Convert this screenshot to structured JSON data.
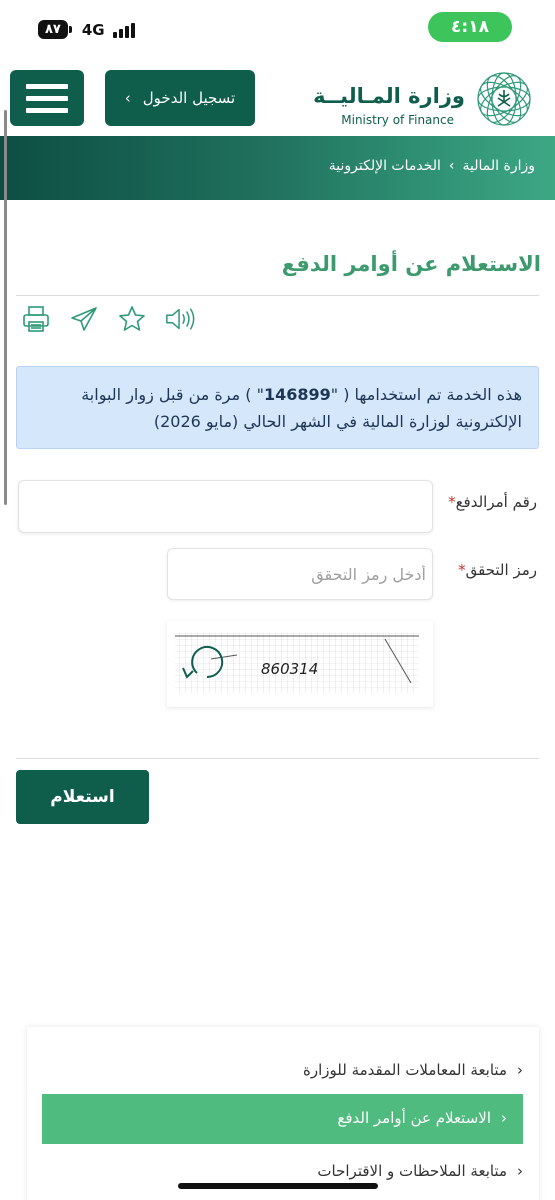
{
  "status_bar": {
    "battery": "٨٧",
    "network": "4G",
    "time": "٤:١٨",
    "time_color": "#3dc55c"
  },
  "header": {
    "login_label": "تسجيل الدخول",
    "login_chevron": "›",
    "logo_ar": "وزارة المـاليــة",
    "logo_en": "Ministry of Finance",
    "brand_color": "#0f5e4c"
  },
  "breadcrumb": {
    "items": [
      "وزارة المالية",
      "الخدمات الإلكترونية"
    ],
    "separator": "›"
  },
  "page": {
    "title": "الاستعلام عن أوامر الدفع",
    "title_color": "#3d9a6e"
  },
  "tools": [
    "print-icon",
    "share-icon",
    "star-icon",
    "speaker-icon"
  ],
  "info": {
    "before": "هذه الخدمة تم استخدامها ( \"",
    "count": "146899",
    "after": "\" ) مرة من قبل زوار البوابة الإلكترونية لوزارة المالية في الشهر الحالي (مايو 2026)"
  },
  "form": {
    "payment_order_label": "رقم أمرالدفع",
    "payment_order_value": "",
    "verification_label": "رمز التحقق",
    "verification_placeholder": "أدخل رمز التحقق",
    "required_mark": "*",
    "captcha_text": "860314",
    "submit_label": "استعلام"
  },
  "bottom_list": {
    "items": [
      {
        "label": "متابعة المعاملات المقدمة للوزارة",
        "active": false
      },
      {
        "label": "الاستعلام عن أوامر الدفع",
        "active": true
      },
      {
        "label": "متابعة الملاحظات و الاقتراحات",
        "active": false
      }
    ],
    "chevron": "‹",
    "active_color": "#4fbb7f"
  }
}
